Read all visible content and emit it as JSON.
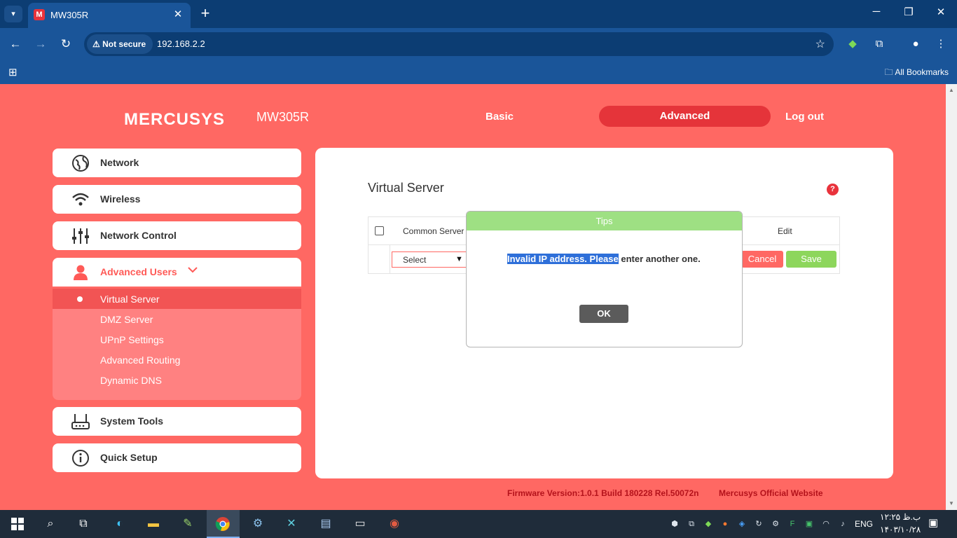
{
  "browser": {
    "tab_title": "MW305R",
    "tab_favicon_letter": "M",
    "security_label": "Not secure",
    "url": "192.168.2.2",
    "bookmarks_label": "All Bookmarks"
  },
  "header": {
    "brand": "MERCUSYS",
    "model": "MW305R",
    "nav": {
      "basic": "Basic",
      "advanced": "Advanced",
      "logout": "Log out"
    }
  },
  "sidebar": {
    "items": [
      {
        "label": "Network",
        "icon": "globe-icon"
      },
      {
        "label": "Wireless",
        "icon": "wifi-icon"
      },
      {
        "label": "Network Control",
        "icon": "sliders-icon"
      },
      {
        "label": "Advanced Users",
        "icon": "user-icon"
      },
      {
        "label": "System Tools",
        "icon": "router-icon"
      },
      {
        "label": "Quick Setup",
        "icon": "info-icon"
      }
    ],
    "submenu": [
      {
        "label": "Virtual Server",
        "active": true
      },
      {
        "label": "DMZ Server"
      },
      {
        "label": "UPnP Settings"
      },
      {
        "label": "Advanced Routing"
      },
      {
        "label": "Dynamic DNS"
      }
    ]
  },
  "main": {
    "title": "Virtual Server",
    "help": "?",
    "table": {
      "col_common_server": "Common Server",
      "col_edit": "Edit",
      "select_value": "Select",
      "cancel": "Cancel",
      "save": "Save"
    }
  },
  "dialog": {
    "title": "Tips",
    "message_selected": "Invalid IP address. Please",
    "message_rest": " enter another one.",
    "ok": "OK"
  },
  "footer": {
    "firmware": "Firmware Version:1.0.1 Build 180228 Rel.50072n",
    "official_site": "Mercusys Official Website"
  },
  "taskbar": {
    "language": "ENG",
    "time": "ب.ظ ۱۲:۲۵",
    "date": "۱۴۰۳/۱۰/۲۸"
  },
  "colors": {
    "page_bg": "#ff6863",
    "active_nav": "#e5343a",
    "dialog_header": "#9ee083",
    "save_green": "#8dd65c",
    "footer_red": "#b4121b"
  }
}
